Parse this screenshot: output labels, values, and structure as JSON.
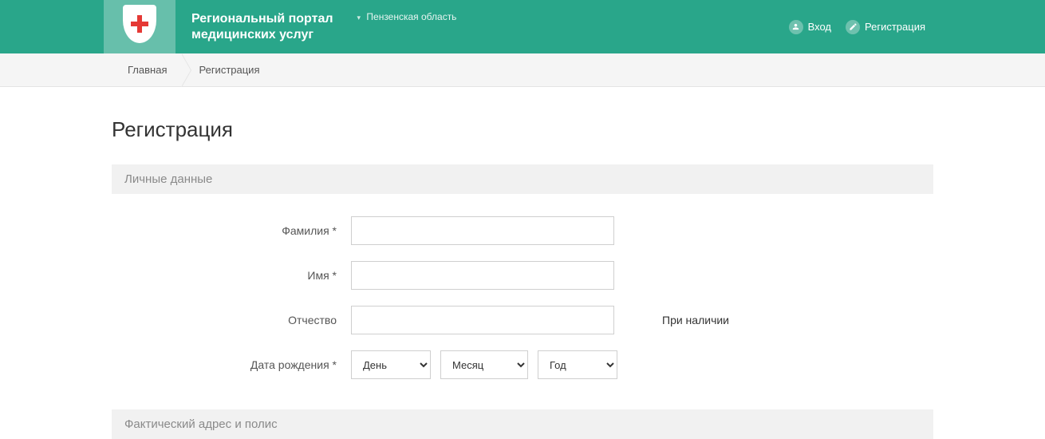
{
  "header": {
    "title_line1": "Региональный портал",
    "title_line2": "медицинских услуг",
    "region": "Пензенская область",
    "login_label": "Вход",
    "register_label": "Регистрация"
  },
  "breadcrumb": {
    "home": "Главная",
    "current": "Регистрация"
  },
  "page": {
    "title": "Регистрация"
  },
  "sections": {
    "personal": "Личные данные",
    "address": "Фактический адрес и полис"
  },
  "form": {
    "lastname_label": "Фамилия *",
    "firstname_label": "Имя *",
    "patronymic_label": "Отчество",
    "patronymic_hint": "При наличии",
    "dob_label": "Дата рождения *",
    "day_option": "День",
    "month_option": "Месяц",
    "year_option": "Год"
  }
}
